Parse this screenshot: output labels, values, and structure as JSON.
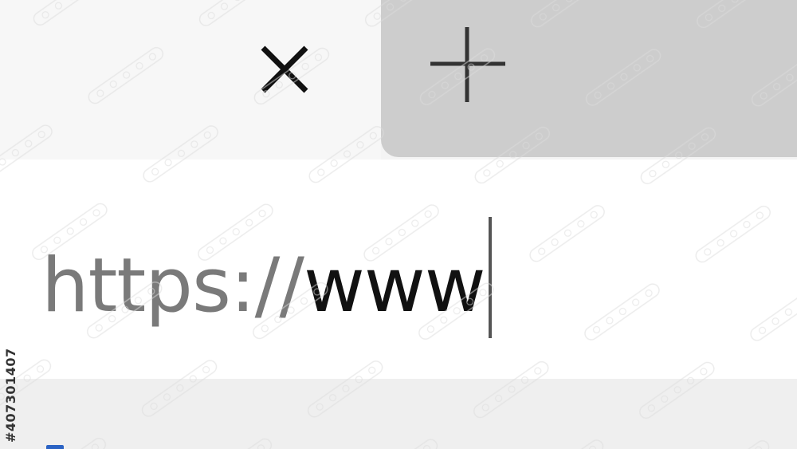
{
  "tab_strip": {
    "close_icon": "close-icon",
    "new_tab_icon": "plus-icon"
  },
  "address_bar": {
    "scheme": "https://",
    "typed": "www"
  },
  "watermark": {
    "id": "#407301407",
    "brand": "Adobe Stock"
  },
  "colors": {
    "active_tab_bg": "#f7f7f7",
    "inactive_tab_bg": "#cdcdcd",
    "scheme_text": "#7a7a7a",
    "typed_text": "#111111",
    "cursor": "#555555",
    "bottom_strip_bg": "#efefef",
    "partial_element": "#2b63c4"
  }
}
